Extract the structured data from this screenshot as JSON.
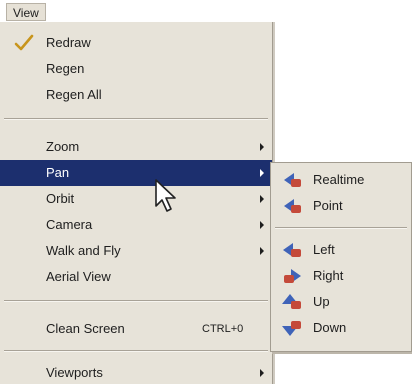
{
  "menubar": {
    "title": "View"
  },
  "menu": {
    "items": [
      {
        "label": "Redraw",
        "checked": true
      },
      {
        "label": "Regen"
      },
      {
        "label": "Regen All"
      },
      {
        "label": "Zoom",
        "submenu": true
      },
      {
        "label": "Pan",
        "submenu": true,
        "selected": true
      },
      {
        "label": "Orbit",
        "submenu": true
      },
      {
        "label": "Camera",
        "submenu": true
      },
      {
        "label": "Walk and Fly",
        "submenu": true
      },
      {
        "label": "Aerial View"
      },
      {
        "label": "Clean Screen",
        "shortcut": "CTRL+0"
      },
      {
        "label": "Viewports",
        "submenu": true
      }
    ]
  },
  "submenu": {
    "items": [
      {
        "label": "Realtime",
        "icon": "pan-realtime-icon"
      },
      {
        "label": "Point",
        "icon": "pan-point-icon"
      },
      {
        "label": "Left",
        "icon": "pan-left-icon"
      },
      {
        "label": "Right",
        "icon": "pan-right-icon"
      },
      {
        "label": "Up",
        "icon": "pan-up-icon"
      },
      {
        "label": "Down",
        "icon": "pan-down-icon"
      }
    ]
  },
  "colors": {
    "menu_background": "#e7e3d9",
    "selection": "#1c2f6e",
    "icon_blue": "#3f63b8",
    "icon_red": "#c44a3a"
  }
}
